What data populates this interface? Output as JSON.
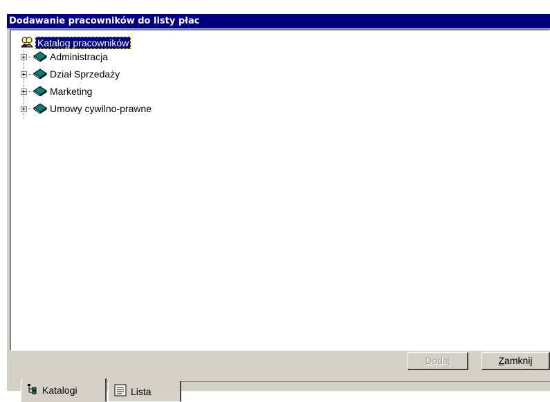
{
  "window": {
    "title": "Dodawanie pracowników do listy płac"
  },
  "tree": {
    "root_label": "Katalog pracowników",
    "items": [
      {
        "label": "Administracja"
      },
      {
        "label": "Dział Sprzedaży"
      },
      {
        "label": "Marketing"
      },
      {
        "label": "Umowy cywilno-prawne"
      }
    ]
  },
  "buttons": {
    "add": {
      "first": "D",
      "rest": "odaj"
    },
    "close": {
      "first": "Z",
      "rest": "amknij"
    }
  },
  "tabs": [
    {
      "label": "Katalogi"
    },
    {
      "label": "Lista"
    }
  ],
  "colors": {
    "titlebar": "#000080",
    "face": "#d4d0c8",
    "book": "#008080"
  },
  "icons": {
    "root": "people-icon",
    "folder": "book-icon",
    "tab_katalogi": "tree-structure-icon",
    "tab_lista": "list-icon"
  }
}
